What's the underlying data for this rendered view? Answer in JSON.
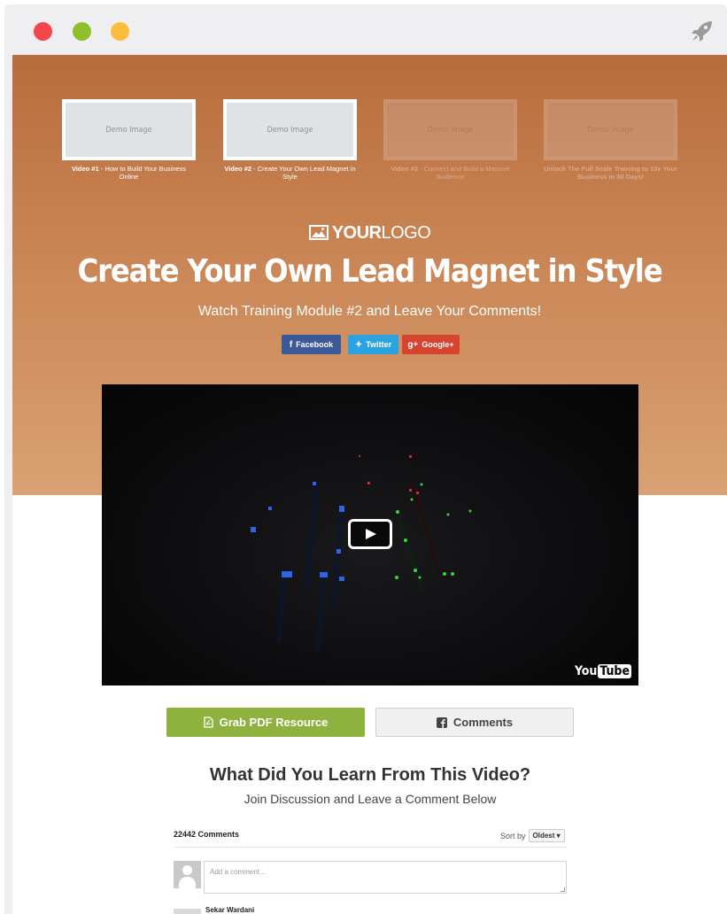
{
  "window": {
    "dot_colors": [
      "#f4474b",
      "#8fbf2a",
      "#fbbd3b"
    ],
    "action_icon": "rocket-icon"
  },
  "theme": {
    "hero_top": "#b96c3c",
    "hero_bottom": "#d9a273",
    "pdf_button": "#8db23e",
    "facebook": "#3b5998",
    "twitter": "#2aa3e0",
    "google": "#d6432f"
  },
  "thumbnails": [
    {
      "image_text": "Demo Image",
      "label_bold": "Video #1",
      "label_rest": " - How to Build Your Business Online",
      "active": true
    },
    {
      "image_text": "Demo Image",
      "label_bold": "Video #2",
      "label_rest": " - Create Your Own Lead Magnet in Style",
      "active": true
    },
    {
      "image_text": "Demo Image",
      "label_bold": "Video #3",
      "label_rest": " - Connect and Build a Massive Audience",
      "active": false
    },
    {
      "image_text": "Demo Image",
      "label_bold": "Unlock The Full Scale Training to 10x Your Business in 30 Days!",
      "label_rest": "",
      "active": false
    }
  ],
  "logo": {
    "bold": "YOUR",
    "light": "LOGO",
    "icon": "image-icon"
  },
  "headline": "Create Your Own Lead Magnet in Style",
  "subheadline": "Watch Training Module #2 and Leave Your Comments!",
  "share": {
    "facebook": {
      "label": "Facebook",
      "icon": "facebook-icon"
    },
    "twitter": {
      "label": "Twitter",
      "icon": "twitter-icon"
    },
    "google": {
      "label": "Google+",
      "icon": "google-plus-icon"
    }
  },
  "video": {
    "brand_you": "You",
    "brand_tube": "Tube",
    "play_icon": "play-icon"
  },
  "buttons": {
    "pdf": {
      "label": "Grab PDF Resource",
      "icon": "pdf-file-icon"
    },
    "comments": {
      "label": "Comments",
      "icon": "facebook-square-icon"
    }
  },
  "learn": {
    "heading": "What Did You Learn From This Video?",
    "subheading": "Join Discussion and Leave a Comment Below"
  },
  "comments_widget": {
    "count_label": "22442 Comments",
    "sort_label": "Sort by",
    "sort_value": "Oldest",
    "input_placeholder": "Add a comment...",
    "first_commenter": "Sekar Wardani"
  }
}
